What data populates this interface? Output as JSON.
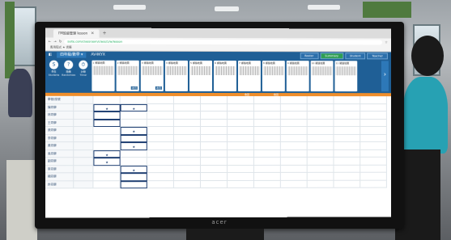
{
  "colors": {
    "app_header": "#1f5f96",
    "ribbon_orange": "#ef8e2b",
    "mode_active": "#2f9e53",
    "cell_border_marked": "#1f3f72"
  },
  "browser": {
    "tab_title": "I'M班級管理 lesson",
    "address_text": "suite.com/classroom/class/1/w/lesson",
    "bookmarks_text": "應用程式 ★ 書籤"
  },
  "app": {
    "class_name": "四年級/數學 ▾",
    "class_code": "AV4KYX",
    "modes": [
      {
        "label": "Roster",
        "active": false
      },
      {
        "label": "Summary",
        "active": true
      },
      {
        "label": "Student",
        "active": false
      },
      {
        "label": "Teacher",
        "active": false
      }
    ],
    "tools": [
      {
        "icon": "student-icon",
        "glyph": "S",
        "label": "學生 Students"
      },
      {
        "icon": "question-icon",
        "glyph": "?",
        "label": "隨機 Randomize"
      },
      {
        "icon": "timer-icon",
        "glyph": "⏱",
        "label": "計時 Timer"
      }
    ],
    "worksheets": [
      {
        "title": "1 鄉鎮地圖",
        "badge": ""
      },
      {
        "title": "2 鄉鎮地圖",
        "badge": "收回"
      },
      {
        "title": "3 鄉鎮地圖",
        "badge": "收回"
      },
      {
        "title": "4 鄉鎮地圖",
        "badge": ""
      },
      {
        "title": "5 鄉鎮地圖",
        "badge": ""
      },
      {
        "title": "6 鄉鎮地圖",
        "badge": ""
      },
      {
        "title": "7 鄉鎮地圖",
        "badge": ""
      },
      {
        "title": "8 鄉鎮地圖",
        "badge": ""
      },
      {
        "title": "9 鄉鎮地圖",
        "badge": ""
      },
      {
        "title": "10 鄉鎮地圖",
        "badge": ""
      },
      {
        "title": "11 鄉鎮地圖",
        "badge": ""
      }
    ],
    "orange_labels": [
      "收回",
      "收回"
    ],
    "rows": [
      {
        "name": "學號/座號",
        "marks": {}
      },
      {
        "name": "陳同學",
        "marks": {
          "2": "★",
          "3": "★"
        }
      },
      {
        "name": "林同學",
        "marks": {
          "2": ""
        }
      },
      {
        "name": "王同學",
        "marks": {
          "2": ""
        }
      },
      {
        "name": "張同學",
        "marks": {
          "3": "★"
        }
      },
      {
        "name": "李同學",
        "marks": {
          "3": ""
        }
      },
      {
        "name": "黃同學",
        "marks": {
          "3": "★"
        }
      },
      {
        "name": "吳同學",
        "marks": {
          "2": "★"
        }
      },
      {
        "name": "劉同學",
        "marks": {
          "2": "★"
        }
      },
      {
        "name": "蔡同學",
        "marks": {
          "3": "★"
        }
      },
      {
        "name": "楊同學",
        "marks": {
          "3": ""
        }
      },
      {
        "name": "許同學",
        "marks": {
          "3": ""
        }
      }
    ],
    "monitor_brand": "acer"
  }
}
